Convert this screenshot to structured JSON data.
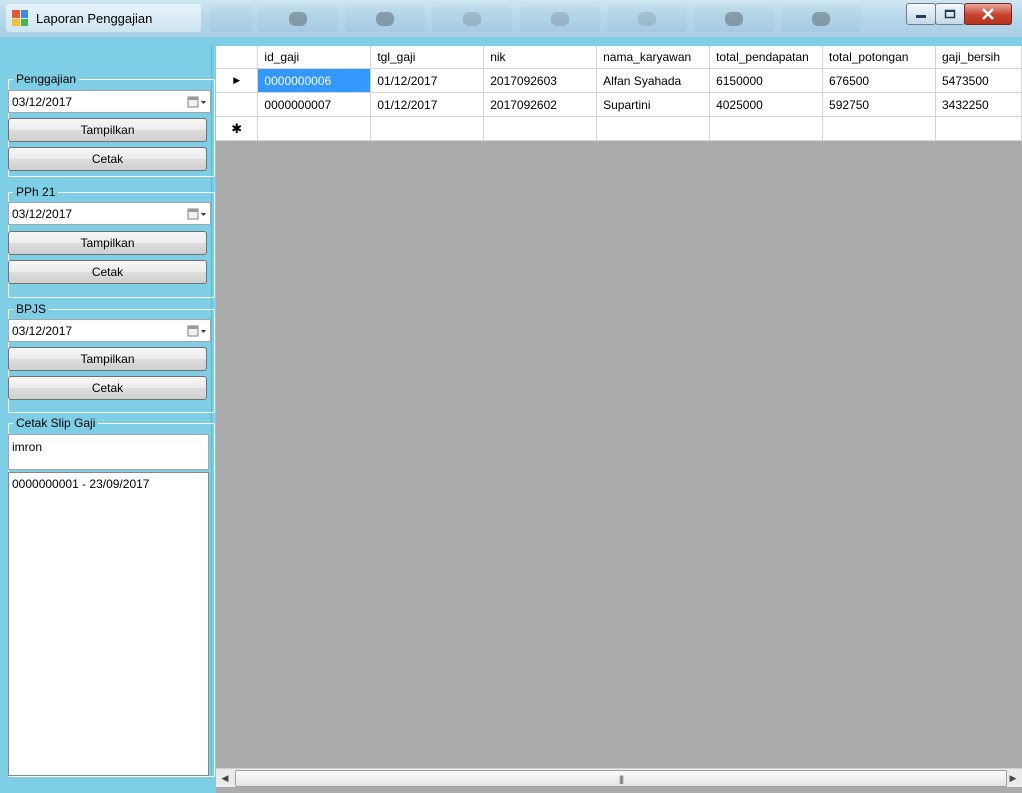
{
  "window": {
    "title": "Laporan Penggajian",
    "caption_buttons": [
      "minimize-icon",
      "maximize-icon",
      "close-icon"
    ]
  },
  "sections": {
    "penggajian": {
      "title": "Penggajian",
      "date": "03/12/2017",
      "show_label": "Tampilkan",
      "print_label": "Cetak"
    },
    "pph21": {
      "title": "PPh 21",
      "date": "03/12/2017",
      "show_label": "Tampilkan",
      "print_label": "Cetak"
    },
    "bpjs": {
      "title": "BPJS",
      "date": "03/12/2017",
      "show_label": "Tampilkan",
      "print_label": "Cetak"
    },
    "slip": {
      "title": "Cetak Slip Gaji",
      "search_value": "imron",
      "list_items": [
        "0000000001 - 23/09/2017"
      ]
    }
  },
  "grid": {
    "columns": [
      "id_gaji",
      "tgl_gaji",
      "nik",
      "nama_karyawan",
      "total_pendapatan",
      "total_potongan",
      "gaji_bersih"
    ],
    "rows": [
      [
        "0000000006",
        "01/12/2017",
        "2017092603",
        "Alfan Syahada",
        "6150000",
        "676500",
        "5473500"
      ],
      [
        "0000000007",
        "01/12/2017",
        "2017092602",
        "Supartini",
        "4025000",
        "592750",
        "3432250"
      ]
    ],
    "current_row_marker": "▶",
    "new_row_marker": "✱",
    "scroll_grip": "|||"
  },
  "colors": {
    "panel_bg": "#7ecfe6",
    "grid_bg": "#ababab",
    "selection": "#3399ff",
    "close_button": "#c7412f"
  }
}
